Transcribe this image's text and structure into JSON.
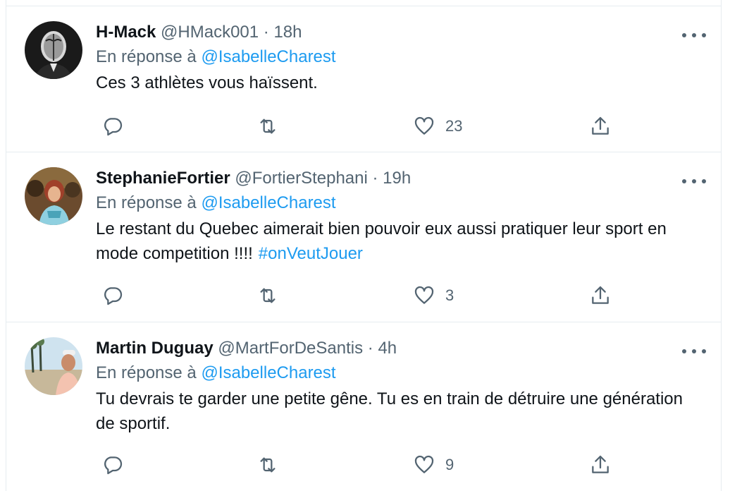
{
  "tweets": [
    {
      "name": "H-Mack",
      "handle": "@HMack001",
      "separator": "·",
      "time": "18h",
      "reply_prefix": "En réponse à",
      "reply_to": "@IsabelleCharest",
      "text": "Ces 3 athlètes vous haïssent.",
      "hashtag": "",
      "like_count": "23"
    },
    {
      "name": "StephanieFortier",
      "handle": "@FortierStephani",
      "separator": "·",
      "time": "19h",
      "reply_prefix": "En réponse à",
      "reply_to": "@IsabelleCharest",
      "text": "Le restant du Quebec aimerait bien pouvoir eux aussi pratiquer leur sport en mode competition !!!!",
      "hashtag": "#onVeutJouer",
      "like_count": "3"
    },
    {
      "name": "Martin Duguay",
      "handle": "@MartForDeSantis",
      "separator": "·",
      "time": "4h",
      "reply_prefix": "En réponse à",
      "reply_to": "@IsabelleCharest",
      "text": "Tu devrais te garder une petite gêne. Tu es en train de détruire une génération de sportif.",
      "hashtag": "",
      "like_count": "9"
    }
  ],
  "icons": {
    "reply": "reply-icon",
    "retweet": "retweet-icon",
    "like": "heart-icon",
    "share": "share-icon",
    "more": "more-icon"
  },
  "colors": {
    "link": "#1d9bf0",
    "secondary_text": "#536471",
    "primary_text": "#0f1419",
    "divider": "#e6ecf0"
  }
}
